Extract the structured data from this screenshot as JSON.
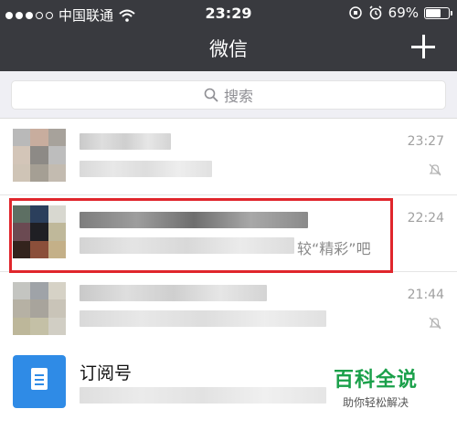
{
  "status_bar": {
    "carrier": "中国联通",
    "time": "23:29",
    "battery": "69%",
    "battery_level": 0.69
  },
  "nav": {
    "title": "微信",
    "add_icon": "plus-icon"
  },
  "search": {
    "placeholder": "搜索",
    "icon": "search-icon"
  },
  "chats": [
    {
      "time": "23:27",
      "muted": true,
      "snippet": ""
    },
    {
      "time": "22:24",
      "muted": false,
      "snippet": "较“精彩”吧"
    },
    {
      "time": "21:44",
      "muted": true,
      "snippet": ""
    }
  ],
  "subscriptions": {
    "title": "订阅号"
  },
  "watermark": {
    "brand": "百科全说",
    "tagline": "助你轻松解决"
  },
  "colors": {
    "header": "#393a3f",
    "highlight": "#e0262c",
    "subscription_icon": "#2f8be6",
    "watermark": "#1aa04a"
  }
}
